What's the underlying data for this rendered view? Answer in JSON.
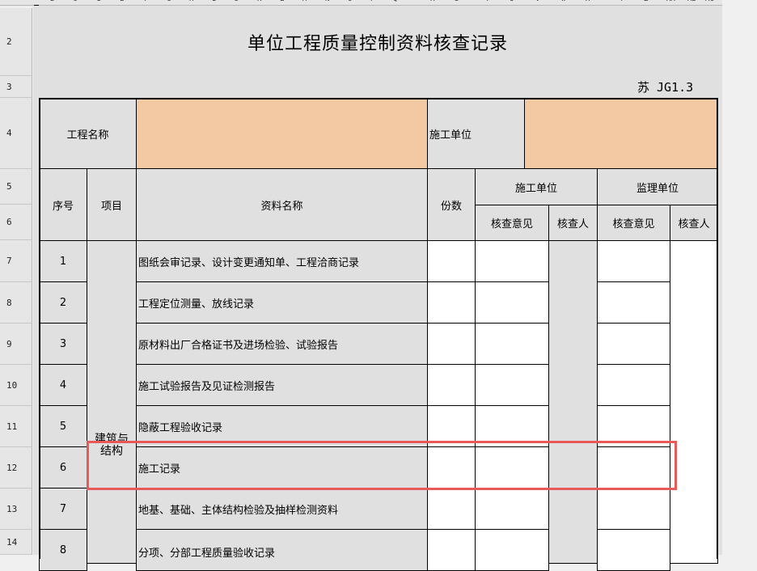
{
  "column_letters": [
    "B",
    "C",
    "D",
    "E",
    "F",
    "G",
    "H",
    "I",
    "J",
    "K",
    "L",
    "M",
    "N",
    "O",
    "P",
    "Q",
    "R",
    "S",
    "T",
    "U",
    "V",
    "W",
    "X",
    "Y",
    "Z",
    "AA",
    "AB",
    "AC"
  ],
  "row_numbers": [
    "2",
    "3",
    "4",
    "5",
    "6",
    "7",
    "8",
    "9",
    "10",
    "11",
    "12",
    "13",
    "14"
  ],
  "title": "单位工程质量控制资料核查记录",
  "form_code": "苏 JG1.3",
  "project_name_label": "工程名称",
  "contractor_label": "施工单位",
  "headers": {
    "seq": "序号",
    "item": "项目",
    "doc_name": "资料名称",
    "copies": "份数",
    "contractor": "施工单位",
    "supervisor": "监理单位",
    "check_opinion": "核查意见",
    "checker": "核查人",
    "check_opinion_2": "核查意见",
    "checker_2": "核查人"
  },
  "category": "建筑与结构",
  "rows": [
    {
      "seq": "1",
      "name": "图纸会审记录、设计变更通知单、工程洽商记录"
    },
    {
      "seq": "2",
      "name": "工程定位测量、放线记录"
    },
    {
      "seq": "3",
      "name": "原材料出厂合格证书及进场检验、试验报告"
    },
    {
      "seq": "4",
      "name": "施工试验报告及见证检测报告"
    },
    {
      "seq": "5",
      "name": "隐蔽工程验收记录"
    },
    {
      "seq": "6",
      "name": "施工记录"
    },
    {
      "seq": "7",
      "name": "地基、基础、主体结构检验及抽样检测资料"
    },
    {
      "seq": "8",
      "name": "分项、分部工程质量验收记录"
    }
  ],
  "colors": {
    "header_fill": "#e0e0e0",
    "input_fill": "#f3c9a4",
    "highlight": "#e85a5a"
  }
}
